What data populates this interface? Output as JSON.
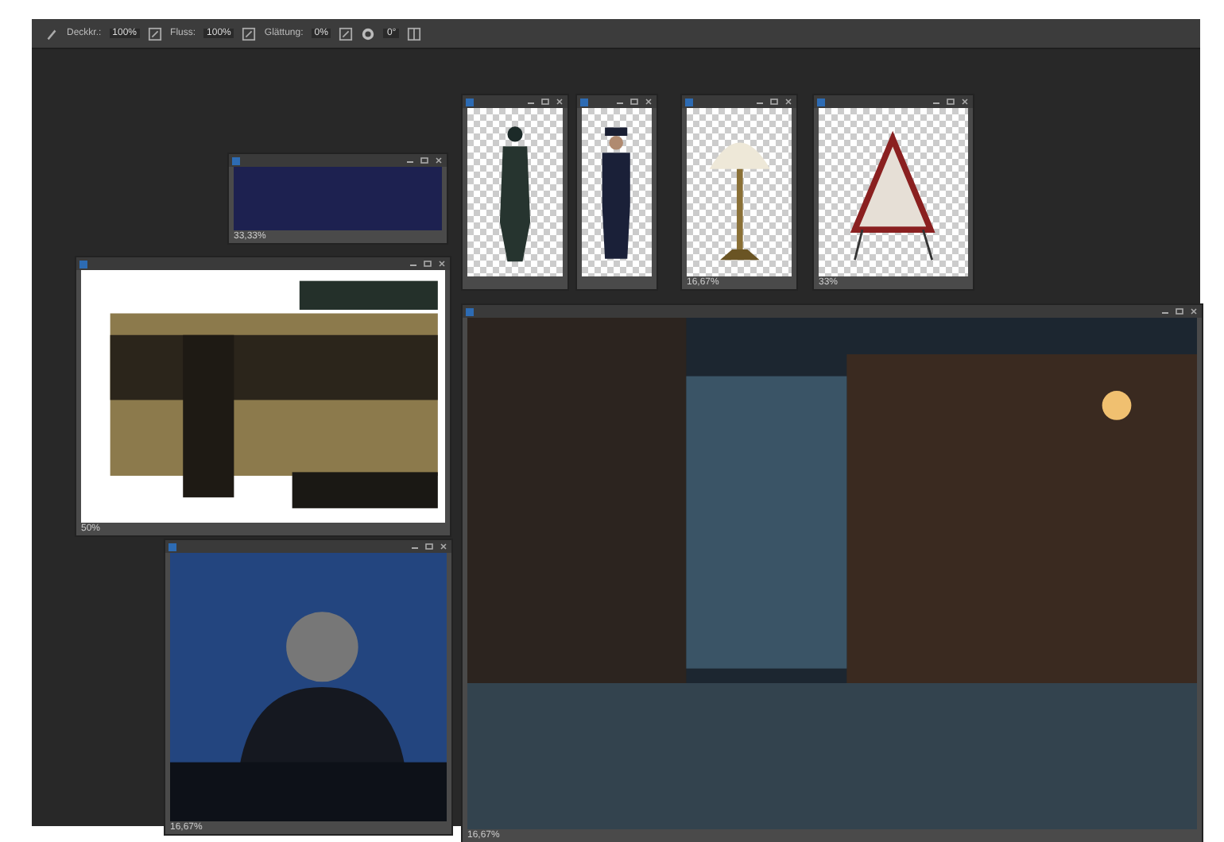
{
  "options_bar": {
    "fields": [
      {
        "label": "Deckkr.:",
        "value": "100%"
      },
      {
        "label": "Fluss:",
        "value": "100%"
      },
      {
        "label": "Glättung:",
        "value": "0%"
      }
    ],
    "angle": "0°"
  },
  "windows": [
    {
      "kind": "photo",
      "zoom": "33,33%"
    },
    {
      "kind": "cutout"
    },
    {
      "kind": "cutout"
    },
    {
      "kind": "cutout",
      "zoom": "16,67%"
    },
    {
      "kind": "cutout",
      "zoom": "33%"
    },
    {
      "kind": "photo",
      "zoom": "50%"
    },
    {
      "kind": "photo",
      "zoom": "16,67%"
    },
    {
      "kind": "photo",
      "zoom": "16,67%"
    }
  ]
}
